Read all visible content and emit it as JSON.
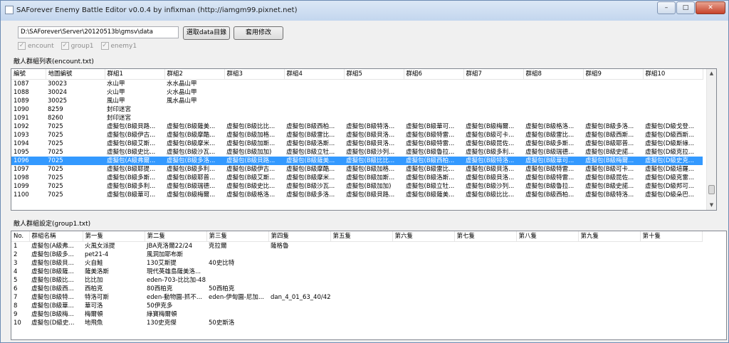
{
  "window": {
    "title": "SAForever Enemy Battle Editor  v0.0.4  by infixman (http://iamgm99.pixnet.net)",
    "minimize": "–",
    "maximize": "□",
    "close": "✕"
  },
  "toolbar": {
    "path_value": "D:\\SAForever\\Server\\20120513b\\gmsv\\data",
    "select_dir_label": "選取data目錄",
    "apply_label": "套用修改"
  },
  "checkboxes": [
    {
      "label": "encount",
      "checked": true
    },
    {
      "label": "group1",
      "checked": true
    },
    {
      "label": "enemy1",
      "checked": true
    }
  ],
  "encount": {
    "label": "敵人群組列表(encount.txt)",
    "columns": [
      "編號",
      "地圖編號",
      "群組1",
      "群組2",
      "群組3",
      "群組4",
      "群組5",
      "群組6",
      "群組7",
      "群組8",
      "群組9",
      "群組10"
    ],
    "rows": [
      [
        "1087",
        "30023",
        "水山甲",
        "水水晶山甲",
        "",
        "",
        "",
        "",
        "",
        "",
        "",
        ""
      ],
      [
        "1088",
        "30024",
        "火山甲",
        "火水晶山甲",
        "",
        "",
        "",
        "",
        "",
        "",
        "",
        ""
      ],
      [
        "1089",
        "30025",
        "風山甲",
        "風水晶山甲",
        "",
        "",
        "",
        "",
        "",
        "",
        "",
        ""
      ],
      [
        "1090",
        "8259",
        "封印迷宮",
        "",
        "",
        "",
        "",
        "",
        "",
        "",
        "",
        ""
      ],
      [
        "1091",
        "8260",
        "封印迷宮",
        "",
        "",
        "",
        "",
        "",
        "",
        "",
        "",
        ""
      ],
      [
        "1092",
        "7025",
        "虛擬包(B級貝路...",
        "虛擬包(B級薩美...",
        "虛擬包(B級比比...",
        "虛擬包(B級西柏...",
        "虛擬包(B級特洛...",
        "虛擬包(B級華可...",
        "虛擬包(B級梅爾...",
        "虛擬包(B級格洛...",
        "虛擬包(B級多洛...",
        "虛擬包(D級戈登..."
      ],
      [
        "1093",
        "7025",
        "虛擬包(B級伊古...",
        "虛擬包(B級摩酷...",
        "虛擬包(B級加格...",
        "虛擬包(B級雷比...",
        "虛擬包(B級貝洛...",
        "虛擬包(B級特雷...",
        "虛擬包(B級可卡...",
        "虛擬包(B級雷比...",
        "虛擬包(B級西斯...",
        "虛擬包(D級西斯..."
      ],
      [
        "1094",
        "7025",
        "虛擬包(B級艾斯...",
        "虛擬包(B級摩米...",
        "虛擬包(B級加斯...",
        "虛擬包(B級洛斯...",
        "虛擬包(B級貝洛...",
        "虛擬包(B級特雷...",
        "虛擬包(B級昆佐...",
        "虛擬包(B級多斯...",
        "虛擬包(B級耶普...",
        "虛擬包(D級斯綠..."
      ],
      [
        "1095",
        "7025",
        "虛擬包(B級史比...",
        "虛擬包(B級沙瓦...",
        "虛擬包(B級加加)",
        "虛擬包(B級立牡...",
        "虛擬包(B級沙列...",
        "虛擬包(B級魯拉...",
        "虛擬包(B級多利...",
        "虛擬包(B級瑞德...",
        "虛擬包(B級史諾...",
        "虛擬包(D級克拉..."
      ],
      [
        "1096",
        "7025",
        "虛擬包(A級弗爾...",
        "虛擬包(B級多洛...",
        "虛擬包(B級貝路...",
        "虛擬包(B級薩美...",
        "虛擬包(B級比比...",
        "虛擬包(B級西柏...",
        "虛擬包(B級特洛...",
        "虛擬包(B級華可...",
        "虛擬包(B級梅爾...",
        "虛擬包(D級史克..."
      ],
      [
        "1097",
        "7025",
        "虛擬包(B級耶提...",
        "虛擬包(B級多利...",
        "虛擬包(B級伊古...",
        "虛擬包(B級摩酷...",
        "虛擬包(B級加格...",
        "虛擬包(B級雷比...",
        "虛擬包(B級貝洛...",
        "虛擬包(B級特雷...",
        "虛擬包(B級可卡...",
        "虛擬包(D級培羅..."
      ],
      [
        "1098",
        "7025",
        "虛擬包(B級多斯...",
        "虛擬包(B級耶普...",
        "虛擬包(B級艾斯...",
        "虛擬包(B級摩米...",
        "虛擬包(B級加斯...",
        "虛擬包(B級洛斯...",
        "虛擬包(B級貝洛...",
        "虛擬包(B級特雷...",
        "虛擬包(B級昆佐...",
        "虛擬包(D級克雷..."
      ],
      [
        "1099",
        "7025",
        "虛擬包(B級多利...",
        "虛擬包(B級瑞德...",
        "虛擬包(B級史比...",
        "虛擬包(B級沙瓦...",
        "虛擬包(B級加加)",
        "虛擬包(B級立牡...",
        "虛擬包(B級沙列...",
        "虛擬包(B級魯拉...",
        "虛擬包(B級史諾...",
        "虛擬包(D級邦可..."
      ],
      [
        "1100",
        "7025",
        "虛擬包(B級華可...",
        "虛擬包(B級梅爾...",
        "虛擬包(B級格洛...",
        "虛擬包(B級多洛...",
        "虛擬包(B級貝路...",
        "虛擬包(B級薩美...",
        "虛擬包(B級比比...",
        "虛擬包(B級西柏...",
        "虛擬包(B級特洛...",
        "虛擬包(D級朵巴..."
      ]
    ],
    "selected_row_index": 9,
    "scroll_position": 0.95
  },
  "group": {
    "label": "敵人群組設定(group1.txt)",
    "columns": [
      "No.",
      "群組名稱",
      "第一隻",
      "第二隻",
      "第三隻",
      "第四隻",
      "第五隻",
      "第六隻",
      "第七隻",
      "第八隻",
      "第九隻",
      "第十隻"
    ],
    "rows": [
      [
        "1",
        "虛擬包(A級弗...",
        "火風女派提",
        "JBA克洛爾22/24",
        "克拉爾",
        "薩格魯",
        "",
        "",
        "",
        "",
        "",
        ""
      ],
      [
        "2",
        "虛擬包(B級多...",
        "pet21-4",
        "風洞加耶布斯",
        "",
        "",
        "",
        "",
        "",
        "",
        "",
        ""
      ],
      [
        "3",
        "虛擬包(B級貝...",
        "火自鮭",
        "130艾斯提",
        "40史比特",
        "",
        "",
        "",
        "",
        "",
        "",
        ""
      ],
      [
        "4",
        "虛擬包(B級薩...",
        "薩美洛斯",
        "現代英雄島薩美洛...",
        "",
        "",
        "",
        "",
        "",
        "",
        "",
        ""
      ],
      [
        "5",
        "虛擬包(B級比...",
        "比比加",
        "eden-703-比比加-48...",
        "",
        "",
        "",
        "",
        "",
        "",
        "",
        ""
      ],
      [
        "6",
        "虛擬包(B級西...",
        "西柏克",
        "80西柏克",
        "50西柏克",
        "",
        "",
        "",
        "",
        "",
        "",
        ""
      ],
      [
        "7",
        "虛擬包(B級特...",
        "特洛可斯",
        "eden-動物園-抓不...",
        "eden-伊甸園-尼加...",
        "dan_4_01_63_40/42",
        "",
        "",
        "",
        "",
        "",
        ""
      ],
      [
        "8",
        "虛擬包(B級華...",
        "華可洛",
        "50伊克多",
        "",
        "",
        "",
        "",
        "",
        "",
        "",
        ""
      ],
      [
        "9",
        "虛擬包(B級梅...",
        "梅爾頓",
        "綠寶梅爾頓",
        "",
        "",
        "",
        "",
        "",
        "",
        "",
        ""
      ],
      [
        "10",
        "虛擬包(D級史...",
        "地飛魚",
        "130史克傑",
        "50史斯洛",
        "",
        "",
        "",
        "",
        "",
        "",
        ""
      ]
    ]
  }
}
